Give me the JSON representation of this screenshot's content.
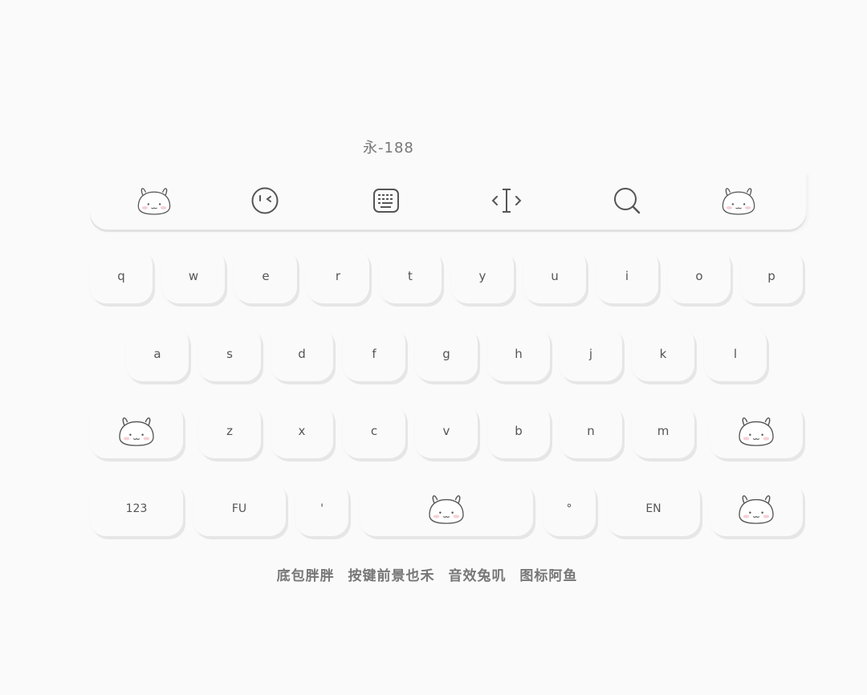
{
  "header": {
    "title": "永-188"
  },
  "toolbar": {
    "items": [
      {
        "name": "bunny-avatar-left",
        "icon": "bunny-icon"
      },
      {
        "name": "emoji",
        "icon": "wink-face-icon"
      },
      {
        "name": "keyboard",
        "icon": "keyboard-icon"
      },
      {
        "name": "cursor",
        "icon": "text-cursor-icon"
      },
      {
        "name": "search",
        "icon": "search-icon"
      },
      {
        "name": "bunny-avatar-right",
        "icon": "bunny-icon"
      }
    ]
  },
  "keyboard": {
    "row1": [
      "q",
      "w",
      "e",
      "r",
      "t",
      "y",
      "u",
      "i",
      "o",
      "p"
    ],
    "row2": [
      "a",
      "s",
      "d",
      "f",
      "g",
      "h",
      "j",
      "k",
      "l"
    ],
    "row3": [
      "z",
      "x",
      "c",
      "v",
      "b",
      "n",
      "m"
    ],
    "row4": {
      "num": "123",
      "fu": "FU",
      "comma": "'",
      "period": "°",
      "en": "EN"
    }
  },
  "footer": {
    "parts": [
      "底包胖胖",
      "按键前景也禾",
      "音效兔叽",
      "图标阿鱼"
    ]
  },
  "colors": {
    "background": "#fafafa",
    "key": "#fafafa",
    "key_shadow": "#e6e6e6",
    "text": "#555555"
  }
}
